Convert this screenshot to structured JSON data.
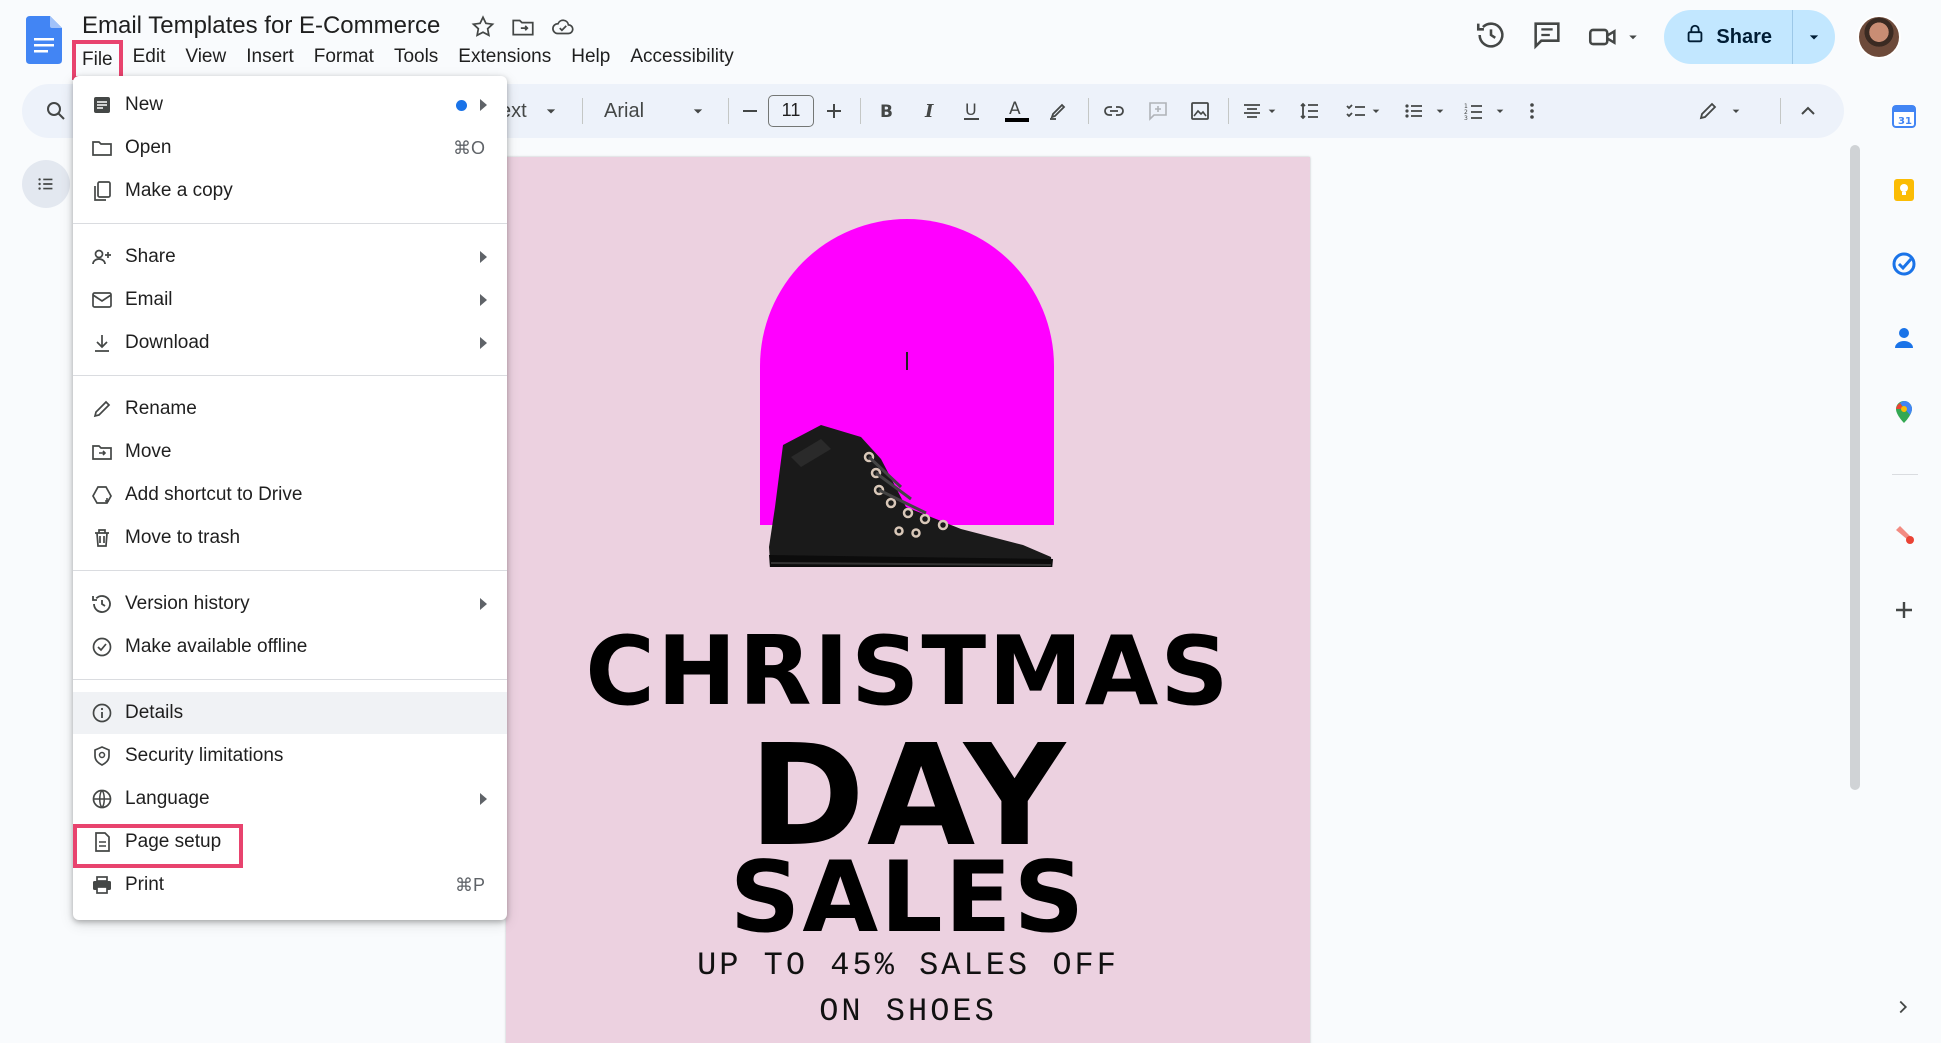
{
  "header": {
    "doc_title": "Email Templates for E-Commerce",
    "menus": [
      "File",
      "Edit",
      "View",
      "Insert",
      "Format",
      "Tools",
      "Extensions",
      "Help",
      "Accessibility"
    ],
    "share_label": "Share"
  },
  "toolbar": {
    "style_label": "ext",
    "font_label": "Arial",
    "font_size": "11"
  },
  "file_menu": {
    "new": "New",
    "open": "Open",
    "open_shortcut": "⌘O",
    "make_copy": "Make a copy",
    "share": "Share",
    "email": "Email",
    "download": "Download",
    "rename": "Rename",
    "move": "Move",
    "add_shortcut": "Add shortcut to Drive",
    "move_trash": "Move to trash",
    "version_history": "Version history",
    "make_offline": "Make available offline",
    "details": "Details",
    "security": "Security limitations",
    "language": "Language",
    "page_setup": "Page setup",
    "print": "Print",
    "print_shortcut": "⌘P"
  },
  "document": {
    "line1": "CHRISTMAS",
    "line2": "DAY",
    "line3": "SALES",
    "sub1": "UP TO 45% SALES OFF",
    "sub2": "ON SHOES"
  },
  "colors": {
    "accent_highlight": "#e8436e",
    "share_bg": "#c2e7ff",
    "page_bg": "#ecd1e0",
    "arch": "#ff00ff"
  }
}
